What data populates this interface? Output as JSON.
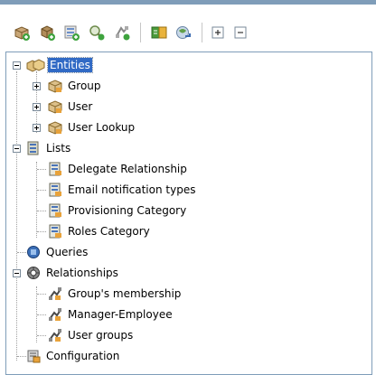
{
  "toolbar": {
    "buttons": [
      {
        "name": "new-entity-button",
        "icon": "entity-add-icon"
      },
      {
        "name": "new-entity-copy-button",
        "icon": "entity-copy-icon"
      },
      {
        "name": "new-list-button",
        "icon": "list-add-icon"
      },
      {
        "name": "new-query-button",
        "icon": "query-search-icon"
      },
      {
        "name": "new-relationship-button",
        "icon": "relationship-add-icon"
      },
      {
        "name": "import-button",
        "icon": "import-icon"
      },
      {
        "name": "export-button",
        "icon": "export-icon"
      },
      {
        "name": "expand-all-button",
        "icon": "expand-all-icon"
      },
      {
        "name": "collapse-all-button",
        "icon": "collapse-all-icon"
      }
    ]
  },
  "tree": {
    "entities": {
      "label": "Entities",
      "children": [
        "Group",
        "User",
        "User Lookup"
      ]
    },
    "lists": {
      "label": "Lists",
      "children": [
        "Delegate Relationship",
        "Email notification types",
        "Provisioning Category",
        "Roles Category"
      ]
    },
    "queries": {
      "label": "Queries"
    },
    "relationships": {
      "label": "Relationships",
      "children": [
        "Group's membership",
        "Manager-Employee",
        "User groups"
      ]
    },
    "configuration": {
      "label": "Configuration"
    }
  },
  "colors": {
    "selection": "#316ac5",
    "panel_border": "#7f9db9",
    "accent": "#d8a640"
  }
}
